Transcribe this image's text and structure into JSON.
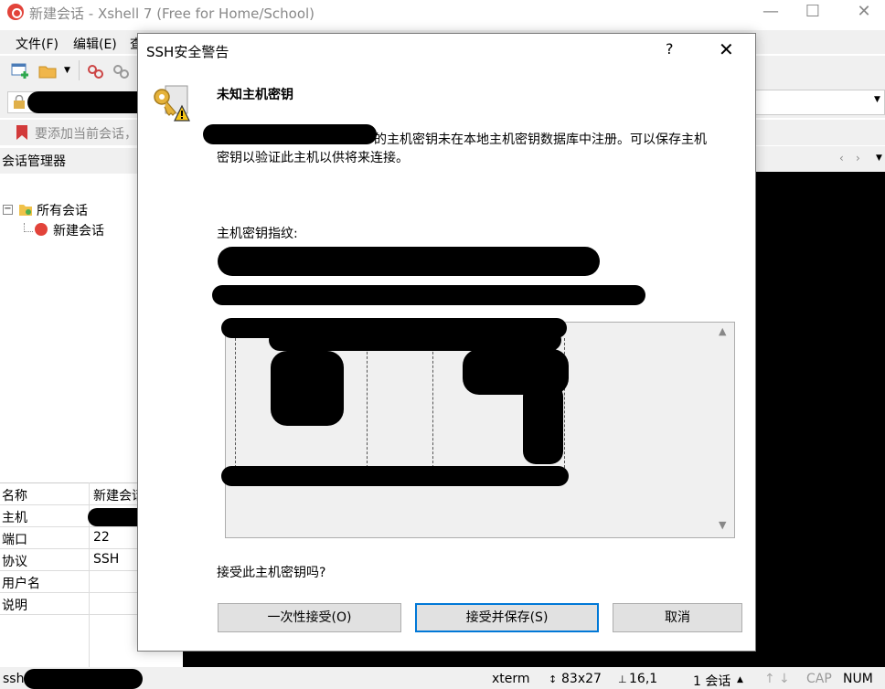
{
  "window": {
    "title": "新建会话 - Xshell 7 (Free for Home/School)",
    "minimize": "—",
    "maximize": "☐",
    "close": "✕"
  },
  "menu": {
    "file": "文件(F)",
    "edit": "编辑(E)",
    "view_partial": "查"
  },
  "hint_bar": {
    "text": "要添加当前会话，"
  },
  "session_manager": {
    "title": "会话管理器",
    "tree": {
      "root": "所有会话",
      "child": "新建会话"
    }
  },
  "properties": [
    {
      "key": "名称",
      "value": "新建会话"
    },
    {
      "key": "主机",
      "value": ""
    },
    {
      "key": "端口",
      "value": "22"
    },
    {
      "key": "协议",
      "value": "SSH"
    },
    {
      "key": "用户名",
      "value": ""
    },
    {
      "key": "说明",
      "value": ""
    }
  ],
  "status_bar": {
    "prefix": "ssh:",
    "term": "xterm",
    "size": "83x27",
    "cursor": "16,1",
    "sessions": "1 会话",
    "cap": "CAP",
    "num": "NUM"
  },
  "dialog": {
    "title": "SSH安全警告",
    "help": "?",
    "close": "✕",
    "heading": "未知主机密钥",
    "message_line1": "的主机密钥未在本地主机密钥数据库中注册。可以保存主机",
    "message_line2": "密钥以验证此主机以供将来连接。",
    "fingerprint_label": "主机密钥指纹:",
    "question": "接受此主机密钥吗?",
    "buttons": {
      "once": "一次性接受(O)",
      "save": "接受并保存(S)",
      "cancel": "取消"
    }
  }
}
